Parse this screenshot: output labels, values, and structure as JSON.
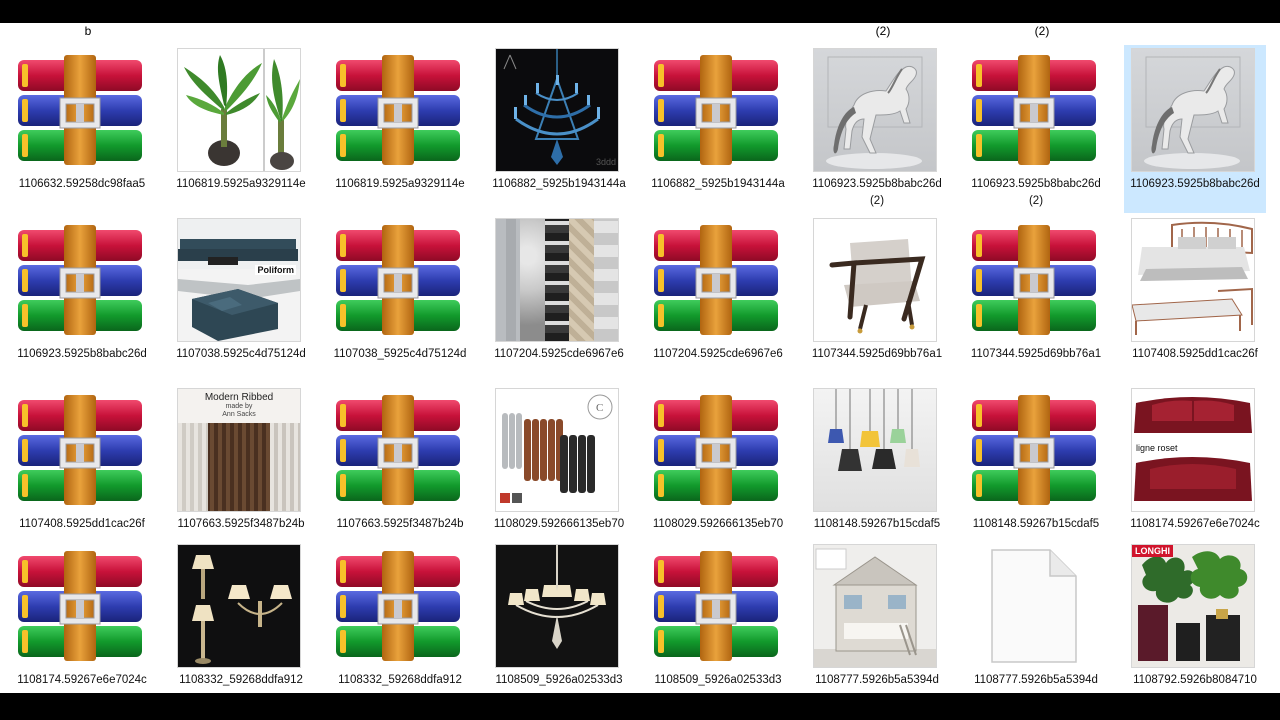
{
  "top_labels": [
    {
      "text": "b"
    },
    {
      "text": "(2)"
    },
    {
      "text": "(2)"
    }
  ],
  "files": [
    {
      "name": "1106632.59258dc98faa5",
      "icon": "winrar-archive-icon"
    },
    {
      "name": "1106819.5925a9329114e",
      "icon": "banana-plant-thumbnail"
    },
    {
      "name": "1106819.5925a9329114e",
      "icon": "winrar-archive-icon"
    },
    {
      "name": "1106882_5925b1943144a",
      "icon": "chandelier-thumbnail"
    },
    {
      "name": "1106882_5925b1943144a",
      "icon": "winrar-archive-icon"
    },
    {
      "name": "1106923.5925b8babc26d (2)",
      "icon": "horse-thumbnail"
    },
    {
      "name": "1106923.5925b8babc26d (2)",
      "icon": "winrar-archive-icon"
    },
    {
      "name": "1106923.5925b8babc26d",
      "icon": "horse-thumbnail",
      "selected": true
    },
    {
      "name": "1106923.5925b8babc26d",
      "icon": "winrar-archive-icon"
    },
    {
      "name": "1107038.5925c4d75124d",
      "icon": "sofa-thumbnail",
      "brand": "Poliform"
    },
    {
      "name": "1107038_5925c4d75124d",
      "icon": "winrar-archive-icon"
    },
    {
      "name": "1107204.5925cde6967e6",
      "icon": "stone-textures-thumbnail"
    },
    {
      "name": "1107204.5925cde6967e6",
      "icon": "winrar-archive-icon"
    },
    {
      "name": "1107344.5925d69bb76a1",
      "icon": "armchair-thumbnail"
    },
    {
      "name": "1107344.5925d69bb76a1",
      "icon": "winrar-archive-icon"
    },
    {
      "name": "1107408.5925dd1cac26f",
      "icon": "bed-thumbnail"
    },
    {
      "name": "1107408.5925dd1cac26f",
      "icon": "winrar-archive-icon"
    },
    {
      "name": "1107663.5925f3487b24b",
      "icon": "ribbed-tile-thumbnail",
      "caption": "Modern Ribbed",
      "caption2": "made by",
      "caption3": "Ann Sacks"
    },
    {
      "name": "1107663.5925f3487b24b",
      "icon": "winrar-archive-icon"
    },
    {
      "name": "1108029.592666135eb70",
      "icon": "radiator-thumbnail"
    },
    {
      "name": "1108029.592666135eb70",
      "icon": "winrar-archive-icon"
    },
    {
      "name": "1108148.59267b15cdaf5",
      "icon": "pendant-lamps-thumbnail"
    },
    {
      "name": "1108148.59267b15cdaf5",
      "icon": "winrar-archive-icon"
    },
    {
      "name": "1108174.59267e6e7024c",
      "icon": "red-sofa-thumbnail",
      "brand": "ligne roset"
    },
    {
      "name": "1108174.59267e6e7024c",
      "icon": "winrar-archive-icon"
    },
    {
      "name": "1108332_59268ddfa912",
      "icon": "wall-lamps-thumbnail"
    },
    {
      "name": "1108332_59268ddfa912",
      "icon": "winrar-archive-icon"
    },
    {
      "name": "1108509_5926a02533d3",
      "icon": "chandelier-white-thumbnail"
    },
    {
      "name": "1108509_5926a02533d3",
      "icon": "winrar-archive-icon"
    },
    {
      "name": "1108777.5926b5a5394d",
      "icon": "kids-house-bed-thumbnail"
    },
    {
      "name": "1108777.5926b5a5394d",
      "icon": "blank-file-icon"
    },
    {
      "name": "1108792.5926b8084710",
      "icon": "potted-plants-thumbnail",
      "brand": "LONGHI"
    }
  ],
  "colors": {
    "selection": "#cce8ff",
    "rar_red": "#d0143c",
    "rar_blue": "#2e3db0",
    "rar_green": "#129a2c",
    "rar_belt": "#d98a1e"
  }
}
